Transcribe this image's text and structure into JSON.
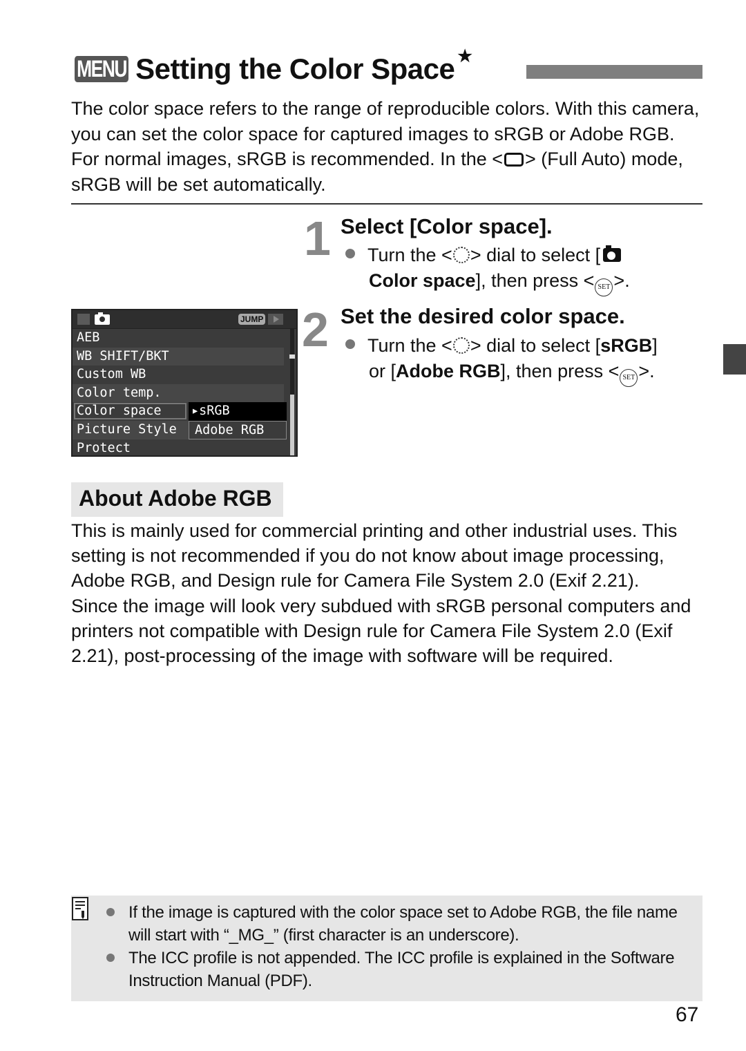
{
  "title": {
    "menu_badge": "MENU",
    "text": "Setting the Color Space",
    "star": "★"
  },
  "intro": {
    "part1": "The color space refers to the range of reproducible colors. With this camera, you can set the color space for captured images to sRGB or Adobe RGB. For normal images, sRGB is recommended. In the <",
    "part2": "> (Full Auto) mode, sRGB will be set automatically.",
    "icon": "full-auto-icon"
  },
  "steps": [
    {
      "number": "1",
      "title": "Select [Color space].",
      "bullet": {
        "t1": "Turn the <",
        "t2": "> dial to select [",
        "bold": "Color space",
        "t3": "], then press <",
        "t4": ">."
      }
    },
    {
      "number": "2",
      "title": "Set the desired color space.",
      "bullet": {
        "t1": "Turn the <",
        "t2": "> dial to select [",
        "bold1": "sRGB",
        "t3": "] or [",
        "bold2": "Adobe RGB",
        "t4": "], then press <",
        "t5": ">."
      }
    }
  ],
  "set_label": "SET",
  "lcd": {
    "jump": "JUMP",
    "items": [
      "AEB",
      "WB SHIFT/BKT",
      "Custom WB",
      "Color temp.",
      "Color space",
      "Picture Style",
      "Protect"
    ],
    "selected_item": "Color space",
    "options": [
      "▸sRGB",
      "Adobe RGB"
    ],
    "selected_option": "sRGB"
  },
  "about": {
    "heading": "About Adobe RGB",
    "p1": "This is mainly used for commercial printing and other industrial uses. This setting is not recommended if you do not know about image processing, Adobe RGB, and Design rule for Camera File System 2.0 (Exif 2.21).",
    "p2": "Since the image will look very subdued with sRGB personal computers and printers not compatible with Design rule for Camera File System 2.0 (Exif 2.21), post-processing of the image with software will be required."
  },
  "notes": [
    "If the image is captured with the color space set to Adobe RGB, the file name will start with “_MG_” (first character is an underscore).",
    "The ICC profile is not appended. The ICC profile is explained in the Software Instruction Manual (PDF)."
  ],
  "page_number": "67"
}
